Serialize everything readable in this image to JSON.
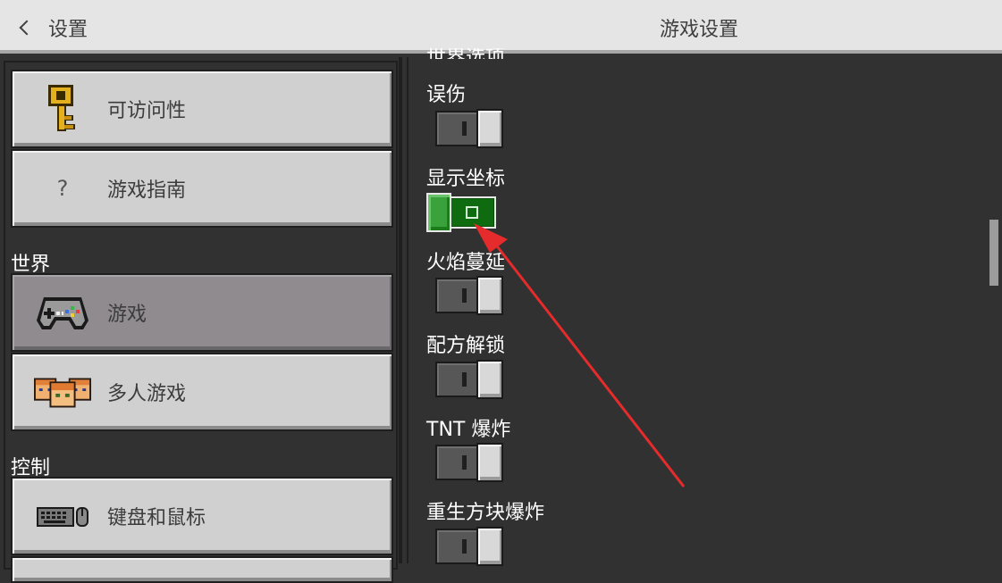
{
  "header": {
    "back_label": "设置",
    "title": "游戏设置"
  },
  "sidebar": {
    "items": [
      {
        "label": "可访问性",
        "icon": "key-icon"
      },
      {
        "label": "游戏指南",
        "icon": "question-icon",
        "icon_text": "?"
      },
      {
        "label": "游戏",
        "icon": "gamepad-icon",
        "selected": true
      },
      {
        "label": "多人游戏",
        "icon": "players-icon"
      },
      {
        "label": "键盘和鼠标",
        "icon": "keyboard-mouse-icon"
      }
    ],
    "sections": {
      "world": "世界",
      "controls": "控制"
    }
  },
  "main": {
    "clipped_top_label": "世界选项",
    "options": [
      {
        "label": "误伤",
        "enabled": false
      },
      {
        "label": "显示坐标",
        "enabled": true
      },
      {
        "label": "火焰蔓延",
        "enabled": false
      },
      {
        "label": "配方解锁",
        "enabled": false
      },
      {
        "label": "TNT 爆炸",
        "enabled": false
      },
      {
        "label": "重生方块爆炸",
        "enabled": false
      }
    ]
  },
  "colors": {
    "header_bg": "#e5e5e5",
    "panel_bg": "#313131",
    "toggle_on": "#3aa23a",
    "annotation_arrow": "#e52b2b"
  }
}
